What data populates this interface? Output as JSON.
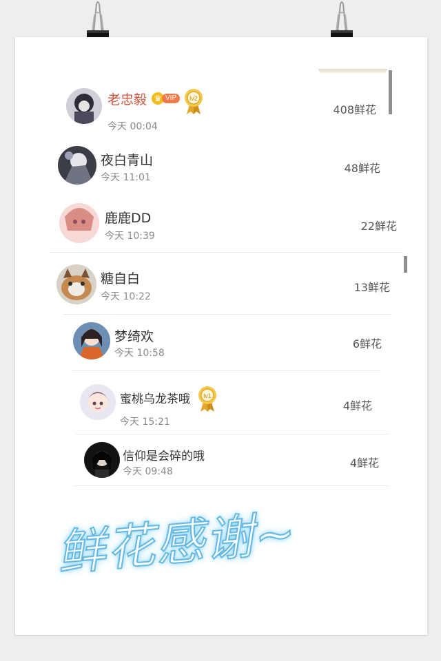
{
  "rows": [
    {
      "name": "老忠毅",
      "time": "今天 00:04",
      "flowers": "408鲜花",
      "vip": "VIP",
      "level": "lv2"
    },
    {
      "name": "夜白青山",
      "time": "今天 11:01",
      "flowers": "48鲜花"
    },
    {
      "name": "鹿鹿DD",
      "time": "今天 10:39",
      "flowers": "22鲜花"
    },
    {
      "name": "糖自白",
      "time": "今天 10:22",
      "flowers": "13鲜花"
    },
    {
      "name": "梦绮欢",
      "time": "今天 10:58",
      "flowers": "6鲜花"
    },
    {
      "name": "蜜桃乌龙茶哦",
      "time": "今天 15:21",
      "flowers": "4鲜花",
      "level": "lv1"
    },
    {
      "name": "信仰是会碎的哦",
      "time": "今天 09:48",
      "flowers": "4鲜花"
    }
  ],
  "banner": {
    "text": "鲜花感谢~"
  },
  "colors": {
    "vip_name": "#d0553c",
    "glow": "#63b8e3",
    "scrollbar": "#8e8e8e"
  },
  "icons": [
    "binder-clip-icon",
    "crown-icon",
    "medal-icon"
  ]
}
